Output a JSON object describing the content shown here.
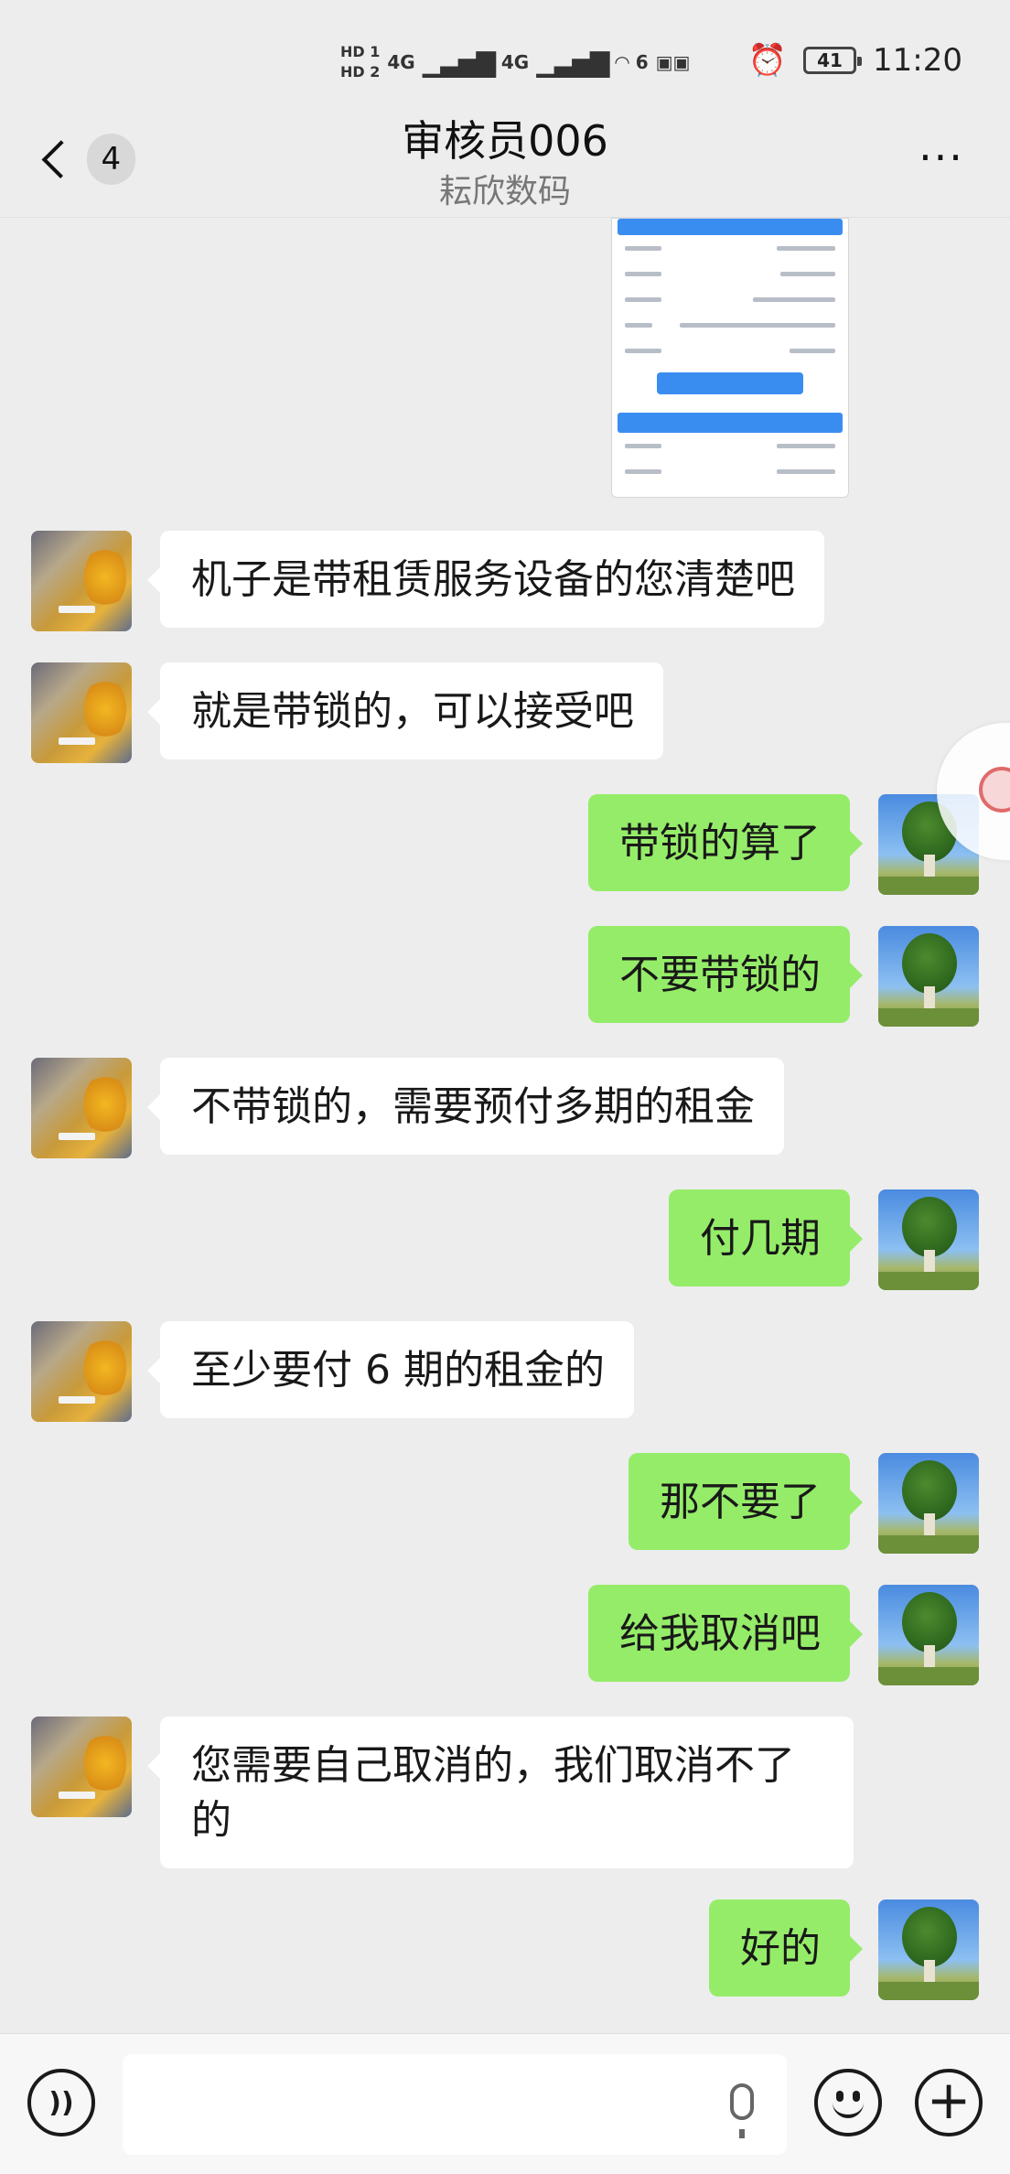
{
  "status_bar": {
    "hd1": "HD 1",
    "hd2": "HD 2",
    "net1": "4G",
    "net2": "4G",
    "wifi": "6",
    "battery": "41",
    "time": "11:20"
  },
  "header": {
    "unread_count": "4",
    "title": "审核员006",
    "subtitle": "耘欣数码"
  },
  "messages": [
    {
      "side": "left",
      "text": "机子是带租赁服务设备的您清楚吧"
    },
    {
      "side": "left",
      "text": "就是带锁的，可以接受吧"
    },
    {
      "side": "right",
      "text": "带锁的算了"
    },
    {
      "side": "right",
      "text": "不要带锁的"
    },
    {
      "side": "left",
      "text": "不带锁的，需要预付多期的租金"
    },
    {
      "side": "right",
      "text": "付几期"
    },
    {
      "side": "left",
      "text": "至少要付 6 期的租金的"
    },
    {
      "side": "right",
      "text": "那不要了"
    },
    {
      "side": "right",
      "text": "给我取消吧"
    },
    {
      "side": "left",
      "text": "您需要自己取消的，我们取消不了\n的"
    },
    {
      "side": "right",
      "text": "好的"
    }
  ],
  "colors": {
    "background": "#ededed",
    "bubble_self": "#95ec69",
    "bubble_other": "#ffffff"
  },
  "icons": {
    "back": "chevron-left-icon",
    "more": "more-dots-icon",
    "voice": "voice-icon",
    "mic": "microphone-icon",
    "emoji": "emoji-icon",
    "plus": "plus-icon"
  }
}
